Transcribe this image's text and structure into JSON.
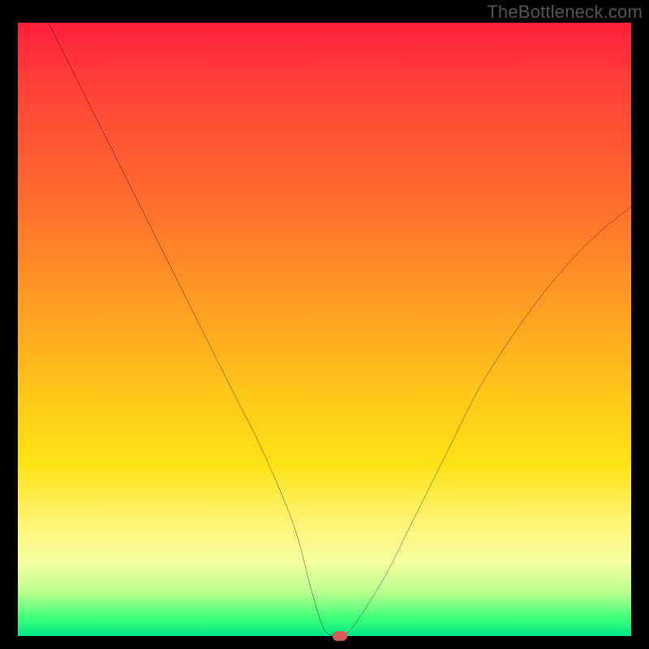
{
  "watermark": "TheBottleneck.com",
  "colors": {
    "page_bg": "#000000",
    "curve": "#000000",
    "marker": "#d85a5a",
    "gradient_top": "#ff1f3a",
    "gradient_bottom": "#00e886"
  },
  "chart_data": {
    "type": "line",
    "title": "",
    "xlabel": "",
    "ylabel": "",
    "xlim": [
      0,
      100
    ],
    "ylim": [
      0,
      100
    ],
    "grid": false,
    "legend": false,
    "series": [
      {
        "name": "bottleneck-curve",
        "x": [
          5,
          10,
          15,
          20,
          25,
          30,
          35,
          40,
          45,
          48,
          50,
          52,
          53,
          55,
          60,
          65,
          70,
          75,
          80,
          85,
          90,
          95,
          100
        ],
        "values": [
          100,
          90,
          80,
          70,
          60,
          50,
          40,
          30,
          18,
          7,
          1,
          0,
          0,
          2,
          10,
          20,
          30,
          40,
          48,
          55,
          61,
          66,
          70
        ]
      }
    ],
    "annotations": [
      {
        "name": "minimum-marker",
        "x": 52.5,
        "y": 0
      }
    ]
  }
}
